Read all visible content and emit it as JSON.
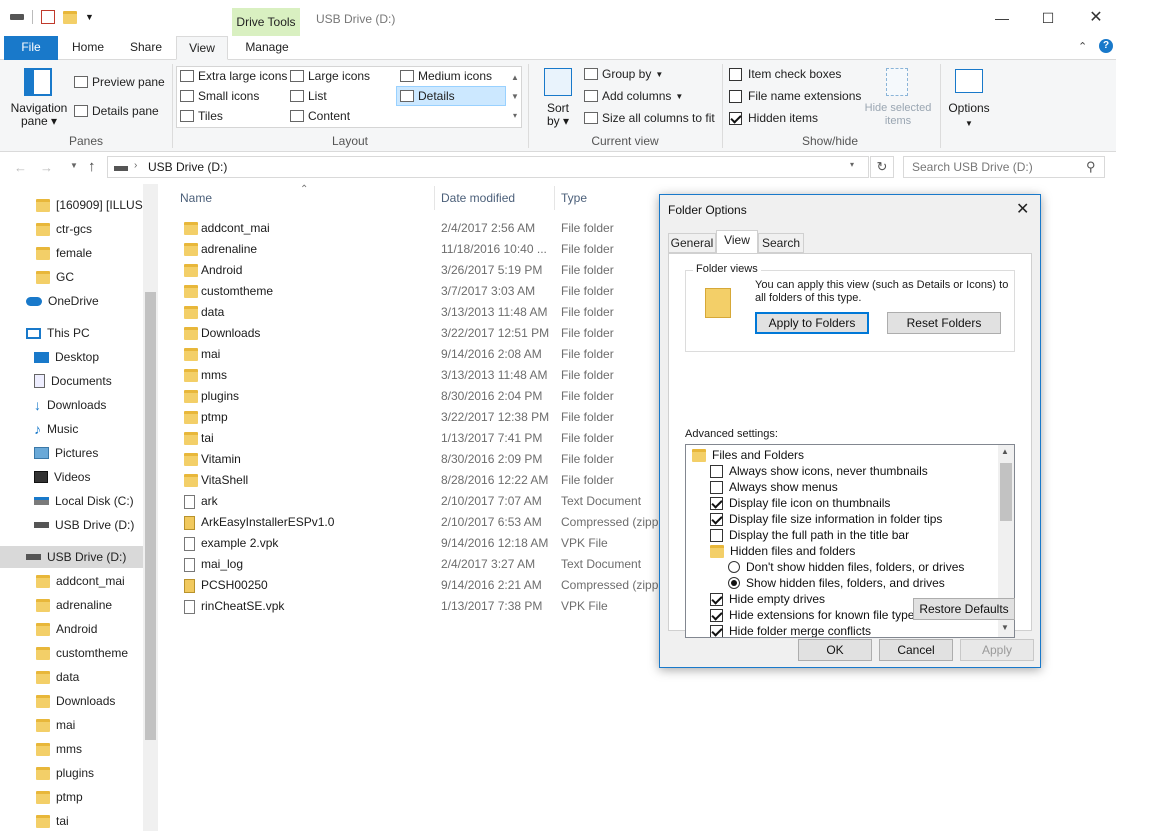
{
  "window": {
    "title": "USB Drive (D:)",
    "context_tab": "Drive Tools"
  },
  "tabs": [
    {
      "label": "File"
    },
    {
      "label": "Home"
    },
    {
      "label": "Share"
    },
    {
      "label": "View"
    },
    {
      "label": "Manage"
    }
  ],
  "ribbon": {
    "panes": {
      "label": "Panes",
      "navigation_pane": "Navigation pane",
      "preview_pane": "Preview pane",
      "details_pane": "Details pane"
    },
    "layout": {
      "label": "Layout",
      "items": [
        "Extra large icons",
        "Large icons",
        "Medium icons",
        "Small icons",
        "List",
        "Details",
        "Tiles",
        "Content"
      ],
      "selected": "Details"
    },
    "current_view": {
      "label": "Current view",
      "sort_by": "Sort by",
      "group_by": "Group by",
      "add_columns": "Add columns",
      "size_all_columns": "Size all columns to fit"
    },
    "show_hide": {
      "label": "Show/hide",
      "item_check_boxes": {
        "label": "Item check boxes",
        "checked": false
      },
      "file_name_extensions": {
        "label": "File name extensions",
        "checked": false
      },
      "hidden_items": {
        "label": "Hidden items",
        "checked": true
      },
      "hide_selected": "Hide selected items"
    },
    "options": "Options"
  },
  "address": {
    "path": "USB Drive (D:)",
    "search_placeholder": "Search USB Drive (D:)"
  },
  "nav": [
    {
      "label": "[160909] [ILLUSI",
      "icon": "folder-icon"
    },
    {
      "label": "ctr-gcs",
      "icon": "folder-icon"
    },
    {
      "label": "female",
      "icon": "folder-icon"
    },
    {
      "label": "GC",
      "icon": "folder-icon"
    },
    {
      "label": "OneDrive",
      "icon": "cloud-icon"
    },
    {
      "label": "This PC",
      "icon": "computer-icon"
    },
    {
      "label": "Desktop",
      "icon": "desktop-icon"
    },
    {
      "label": "Documents",
      "icon": "documents-icon"
    },
    {
      "label": "Downloads",
      "icon": "download-icon"
    },
    {
      "label": "Music",
      "icon": "music-icon"
    },
    {
      "label": "Pictures",
      "icon": "pictures-icon"
    },
    {
      "label": "Videos",
      "icon": "videos-icon"
    },
    {
      "label": "Local Disk (C:)",
      "icon": "disk-icon"
    },
    {
      "label": "USB Drive (D:)",
      "icon": "usb-drive-icon"
    },
    {
      "label": "USB Drive (D:)",
      "icon": "usb-drive-icon"
    },
    {
      "label": "addcont_mai",
      "icon": "folder-icon"
    },
    {
      "label": "adrenaline",
      "icon": "folder-icon"
    },
    {
      "label": "Android",
      "icon": "folder-icon"
    },
    {
      "label": "customtheme",
      "icon": "folder-icon"
    },
    {
      "label": "data",
      "icon": "folder-icon"
    },
    {
      "label": "Downloads",
      "icon": "folder-icon"
    },
    {
      "label": "mai",
      "icon": "folder-icon"
    },
    {
      "label": "mms",
      "icon": "folder-icon"
    },
    {
      "label": "plugins",
      "icon": "folder-icon"
    },
    {
      "label": "ptmp",
      "icon": "folder-icon"
    },
    {
      "label": "tai",
      "icon": "folder-icon"
    }
  ],
  "columns": {
    "name": "Name",
    "date": "Date modified",
    "type": "Type"
  },
  "files": [
    {
      "name": "addcont_mai",
      "date": "2/4/2017 2:56 AM",
      "type": "File folder",
      "kind": "folder"
    },
    {
      "name": "adrenaline",
      "date": "11/18/2016 10:40 ...",
      "type": "File folder",
      "kind": "folder"
    },
    {
      "name": "Android",
      "date": "3/26/2017 5:19 PM",
      "type": "File folder",
      "kind": "folder"
    },
    {
      "name": "customtheme",
      "date": "3/7/2017 3:03 AM",
      "type": "File folder",
      "kind": "folder"
    },
    {
      "name": "data",
      "date": "3/13/2013 11:48 AM",
      "type": "File folder",
      "kind": "folder"
    },
    {
      "name": "Downloads",
      "date": "3/22/2017 12:51 PM",
      "type": "File folder",
      "kind": "folder"
    },
    {
      "name": "mai",
      "date": "9/14/2016 2:08 AM",
      "type": "File folder",
      "kind": "folder"
    },
    {
      "name": "mms",
      "date": "3/13/2013 11:48 AM",
      "type": "File folder",
      "kind": "folder"
    },
    {
      "name": "plugins",
      "date": "8/30/2016 2:04 PM",
      "type": "File folder",
      "kind": "folder"
    },
    {
      "name": "ptmp",
      "date": "3/22/2017 12:38 PM",
      "type": "File folder",
      "kind": "folder"
    },
    {
      "name": "tai",
      "date": "1/13/2017 7:41 PM",
      "type": "File folder",
      "kind": "folder"
    },
    {
      "name": "Vitamin",
      "date": "8/30/2016 2:09 PM",
      "type": "File folder",
      "kind": "folder"
    },
    {
      "name": "VitaShell",
      "date": "8/28/2016 12:22 AM",
      "type": "File folder",
      "kind": "folder"
    },
    {
      "name": "ark",
      "date": "2/10/2017 7:07 AM",
      "type": "Text Document",
      "kind": "text"
    },
    {
      "name": "ArkEasyInstallerESPv1.0",
      "date": "2/10/2017 6:53 AM",
      "type": "Compressed (zipp...",
      "kind": "zip"
    },
    {
      "name": "example 2.vpk",
      "date": "9/14/2016 12:18 AM",
      "type": "VPK File",
      "kind": "file"
    },
    {
      "name": "mai_log",
      "date": "2/4/2017 3:27 AM",
      "type": "Text Document",
      "kind": "text"
    },
    {
      "name": "PCSH00250",
      "date": "9/14/2016 2:21 AM",
      "type": "Compressed (zipp...",
      "kind": "zip"
    },
    {
      "name": "rinCheatSE.vpk",
      "date": "1/13/2017 7:38 PM",
      "type": "VPK File",
      "kind": "file"
    }
  ],
  "dialog": {
    "title": "Folder Options",
    "tabs": [
      "General",
      "View",
      "Search"
    ],
    "active_tab": "View",
    "folder_views": {
      "label": "Folder views",
      "text_line1": "You can apply this view (such as Details or Icons) to",
      "text_line2": "all folders of this type.",
      "apply_button": "Apply to Folders",
      "reset_button": "Reset Folders"
    },
    "advanced_label": "Advanced settings:",
    "advanced": [
      {
        "label": "Files and Folders",
        "kind": "folder",
        "indent": 0
      },
      {
        "label": "Always show icons, never thumbnails",
        "kind": "check",
        "checked": false,
        "indent": 1
      },
      {
        "label": "Always show menus",
        "kind": "check",
        "checked": false,
        "indent": 1
      },
      {
        "label": "Display file icon on thumbnails",
        "kind": "check",
        "checked": true,
        "indent": 1
      },
      {
        "label": "Display file size information in folder tips",
        "kind": "check",
        "checked": true,
        "indent": 1
      },
      {
        "label": "Display the full path in the title bar",
        "kind": "check",
        "checked": false,
        "indent": 1
      },
      {
        "label": "Hidden files and folders",
        "kind": "folder",
        "indent": 1
      },
      {
        "label": "Don't show hidden files, folders, or drives",
        "kind": "radio",
        "checked": false,
        "indent": 2
      },
      {
        "label": "Show hidden files, folders, and drives",
        "kind": "radio",
        "checked": true,
        "indent": 2
      },
      {
        "label": "Hide empty drives",
        "kind": "check",
        "checked": true,
        "indent": 1
      },
      {
        "label": "Hide extensions for known file types",
        "kind": "check",
        "checked": true,
        "indent": 1
      },
      {
        "label": "Hide folder merge conflicts",
        "kind": "check",
        "checked": true,
        "indent": 1
      }
    ],
    "restore_defaults": "Restore Defaults",
    "ok": "OK",
    "cancel": "Cancel",
    "apply": "Apply"
  }
}
